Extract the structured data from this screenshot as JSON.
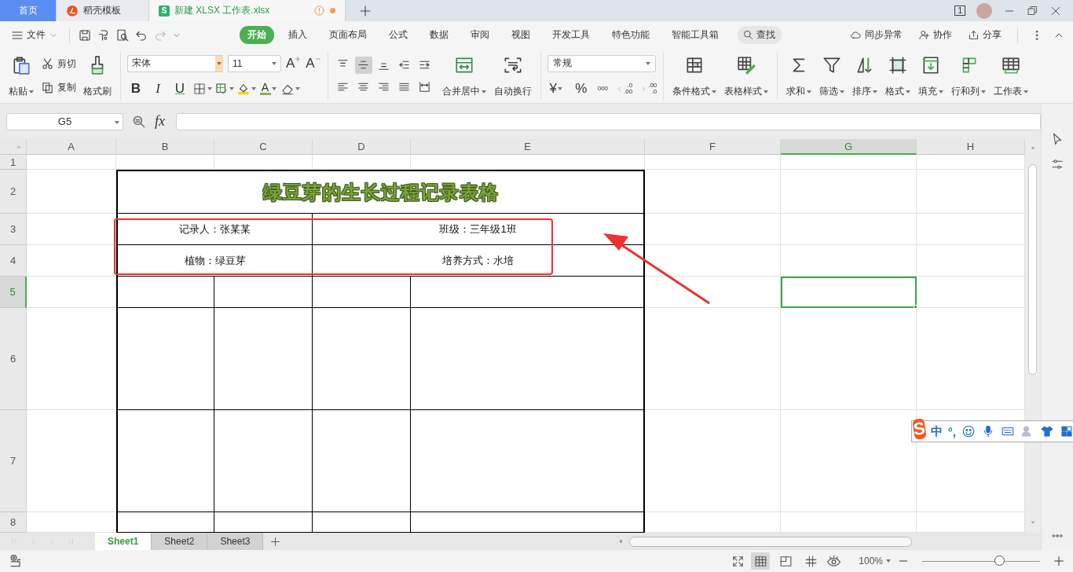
{
  "title_bar": {
    "tabs": [
      {
        "label": "首页",
        "kind": "home",
        "selected": false
      },
      {
        "label": "稻壳模板",
        "kind": "docer",
        "selected": false
      },
      {
        "label": "新建 XLSX 工作表.xlsx",
        "kind": "sheet",
        "icon_text": "S",
        "selected": true,
        "unsaved": true
      }
    ],
    "page_count": "1"
  },
  "menu_bar": {
    "file": "文件",
    "tabs": [
      {
        "label": "开始",
        "selected": true
      },
      {
        "label": "插入",
        "selected": false
      },
      {
        "label": "页面布局",
        "selected": false
      },
      {
        "label": "公式",
        "selected": false
      },
      {
        "label": "数据",
        "selected": false
      },
      {
        "label": "审阅",
        "selected": false
      },
      {
        "label": "视图",
        "selected": false
      },
      {
        "label": "开发工具",
        "selected": false
      },
      {
        "label": "特色功能",
        "selected": false
      },
      {
        "label": "智能工具箱",
        "selected": false
      }
    ],
    "search": "查找",
    "actions": [
      "同步异常",
      "协作",
      "分享"
    ]
  },
  "ribbon": {
    "clipboard": [
      {
        "label": "粘贴",
        "kind": "large",
        "menu": true
      },
      {
        "label": "剪切",
        "kind": "small"
      },
      {
        "label": "复制",
        "kind": "small"
      },
      {
        "label": "格式刷",
        "kind": "large"
      }
    ],
    "font": {
      "name": "宋体",
      "size": "11",
      "grow": "A",
      "shrink": "A",
      "bold": "B",
      "italic": "I",
      "underline": "U",
      "font_color": "A"
    },
    "alignment": [
      {
        "selected": false
      },
      {
        "selected": true
      },
      {
        "selected": false
      },
      {
        "selected": false
      },
      {
        "selected": false
      },
      {
        "selected": false
      },
      {
        "selected": false
      },
      {
        "selected": false
      },
      {
        "selected": false
      },
      {
        "selected": false
      }
    ],
    "merge": [
      {
        "label": "合并居中",
        "menu": true
      },
      {
        "label": "自动换行"
      }
    ],
    "number": {
      "format": "常规",
      "currency": "¥",
      "percent": "%",
      "thousands": "000",
      "decimals": [
        {
          "top": ".0",
          "bottom": ".00"
        },
        {
          "top": ".00",
          "bottom": ".0"
        }
      ]
    },
    "styles": [
      {
        "label": "条件格式",
        "menu": true
      },
      {
        "label": "表格样式",
        "menu": true
      }
    ],
    "cell_tools": [
      {
        "label": "求和",
        "menu": true
      },
      {
        "label": "筛选",
        "menu": true
      },
      {
        "label": "排序",
        "menu": true
      },
      {
        "label": "格式",
        "menu": true
      },
      {
        "label": "填充",
        "menu": true
      },
      {
        "label": "行和列",
        "menu": true
      },
      {
        "label": "工作表",
        "menu": true
      }
    ]
  },
  "formula_bar": {
    "name_box": "G5",
    "function_label": "fx"
  },
  "sheet": {
    "columns": [
      {
        "label": "A",
        "selected": false
      },
      {
        "label": "B",
        "selected": false
      },
      {
        "label": "C",
        "selected": false
      },
      {
        "label": "D",
        "selected": false
      },
      {
        "label": "E",
        "selected": false
      },
      {
        "label": "F",
        "selected": false
      },
      {
        "label": "G",
        "selected": true
      },
      {
        "label": "H",
        "selected": false
      }
    ],
    "rows": [
      {
        "label": "1",
        "selected": false
      },
      {
        "label": "2",
        "selected": false
      },
      {
        "label": "3",
        "selected": false
      },
      {
        "label": "4",
        "selected": false
      },
      {
        "label": "5",
        "selected": true
      },
      {
        "label": "6",
        "selected": false
      },
      {
        "label": "7",
        "selected": false
      },
      {
        "label": "8",
        "selected": false
      }
    ],
    "table": [
      {
        "kind": "title",
        "cells": [
          {
            "text": "绿豆芽的生长过程记录表格"
          }
        ]
      },
      {
        "kind": "pair",
        "cells": [
          {
            "text": "记录人：张某某"
          },
          {
            "text": "班级：三年级1班"
          }
        ]
      },
      {
        "kind": "pair",
        "cells": [
          {
            "text": "植物：绿豆芽"
          },
          {
            "text": "培养方式：水培"
          }
        ]
      },
      {
        "kind": "grid"
      },
      {
        "kind": "grid"
      },
      {
        "kind": "grid"
      },
      {
        "kind": "grid"
      }
    ],
    "highlight_box": true,
    "arrow": true
  },
  "sheet_tabs": [
    {
      "label": "Sheet1",
      "selected": true
    },
    {
      "label": "Sheet2",
      "selected": false
    },
    {
      "label": "Sheet3",
      "selected": false
    }
  ],
  "status_bar": {
    "views": [
      {
        "selected": true
      },
      {
        "selected": false
      },
      {
        "selected": false
      }
    ],
    "zoom": "100%",
    "zoom_slider": {
      "level": 0.65
    }
  },
  "ime_toolbar": {
    "logo": "S",
    "items": [
      {
        "kind": "text",
        "text": "中"
      },
      {
        "kind": "text",
        "text": "°,"
      },
      {
        "kind": "smiley"
      },
      {
        "kind": "mic"
      },
      {
        "kind": "keyboard"
      },
      {
        "kind": "user"
      },
      {
        "kind": "shirt"
      },
      {
        "kind": "grid"
      }
    ]
  }
}
